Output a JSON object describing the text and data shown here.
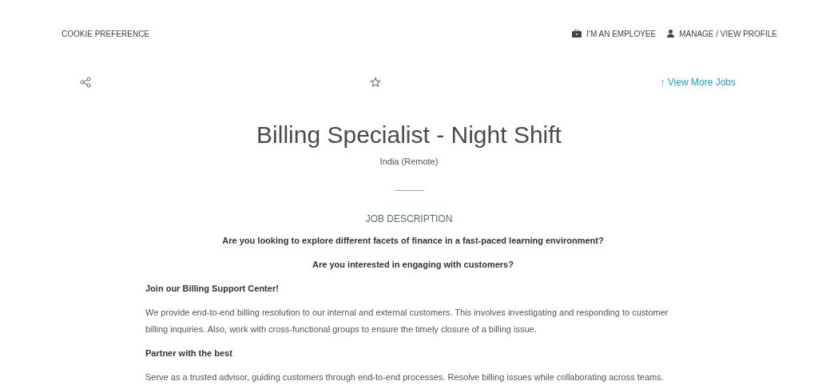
{
  "top_bar": {
    "cookie_link": "COOKIE PREFERENCE",
    "links": [
      {
        "kind": "employee",
        "label": "I'M AN EMPLOYEE"
      },
      {
        "kind": "profile",
        "label": "MANAGE / VIEW PROFILE"
      }
    ]
  },
  "actions": {
    "favorite": false,
    "more_jobs": "↑ View More Jobs"
  },
  "job": {
    "title": "Billing Specialist - Night Shift",
    "location": "India (Remote)"
  },
  "description": {
    "heading": "JOB DESCRIPTION",
    "blocks": [
      {
        "kind": "question",
        "text": "Are you looking to explore different facets of finance in a fast-paced learning environment?"
      },
      {
        "kind": "question",
        "text": "Are you interested in engaging with customers?"
      },
      {
        "kind": "heading",
        "text": "Join our Billing Support Center!"
      },
      {
        "kind": "paragraph",
        "text": "We provide end-to-end billing resolution to our internal and external customers. This involves investigating and responding to customer billing inquiries. Also, work with cross-functional groups to ensure the timely closure of a billing issue."
      },
      {
        "kind": "heading",
        "text": "Partner with the best"
      },
      {
        "kind": "paragraph",
        "text": "Serve as a trusted advisor, guiding customers through end-to-end processes. Resolve billing issues while collaborating across teams."
      }
    ]
  }
}
